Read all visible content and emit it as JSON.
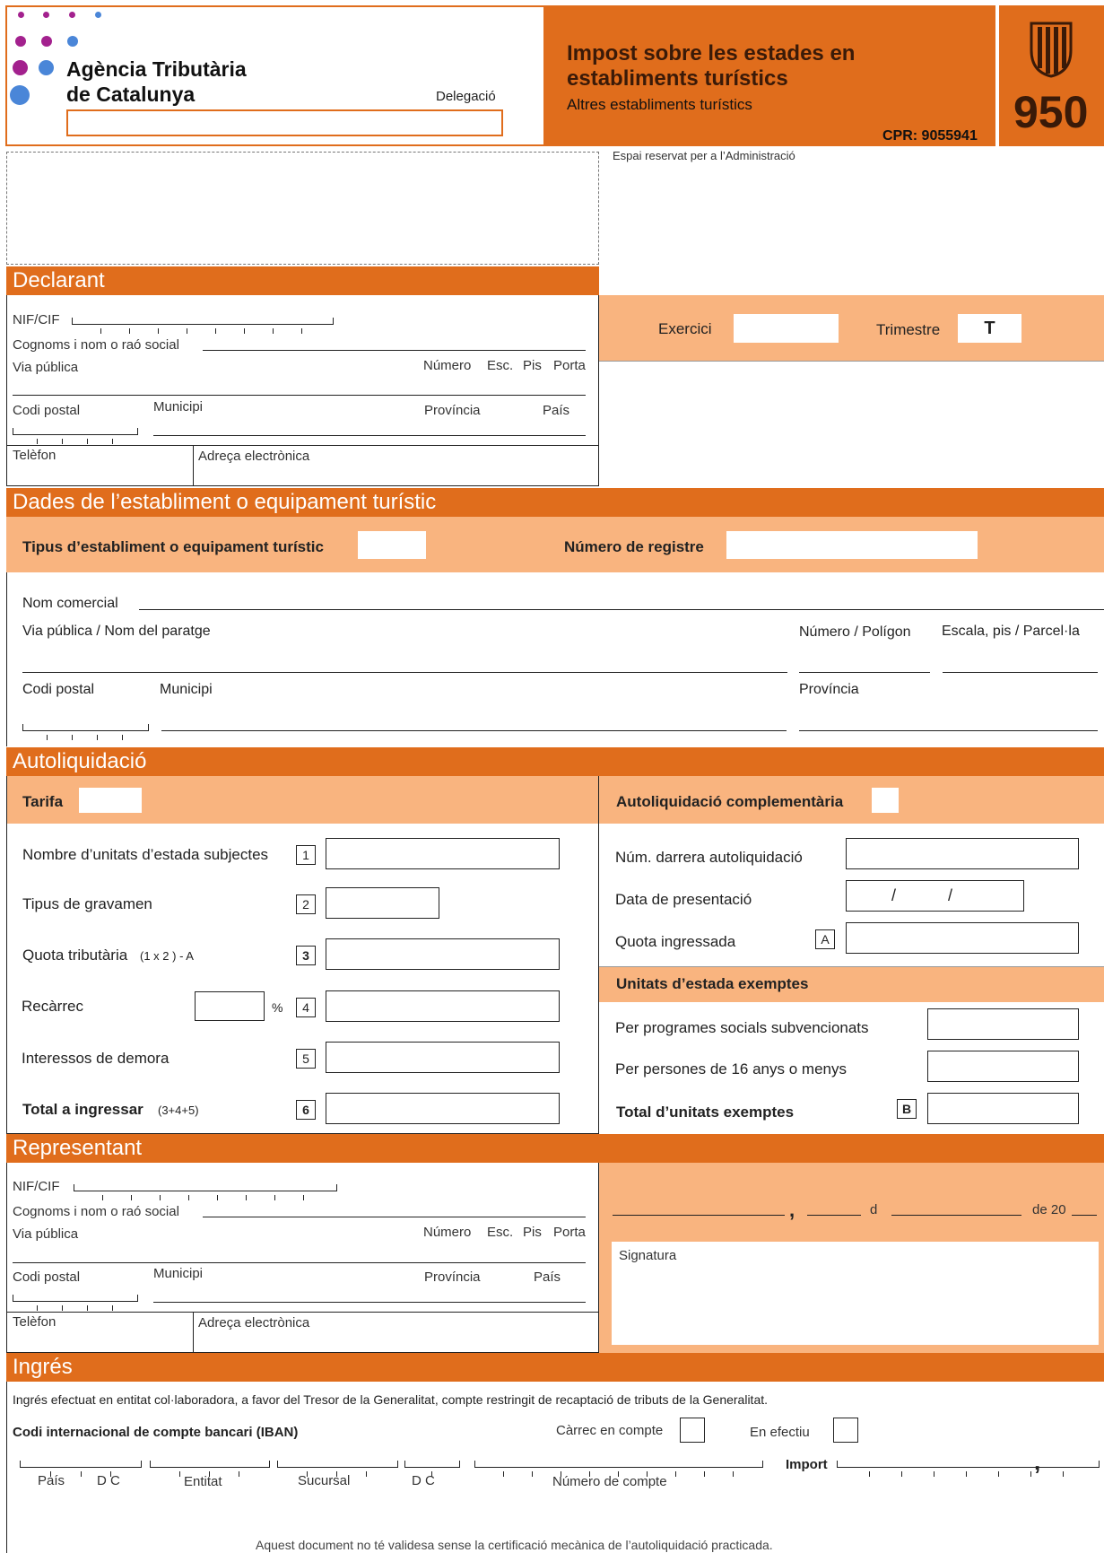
{
  "header": {
    "agency_line1": "Agència Tributària",
    "agency_line2": "de Catalunya",
    "delegacio_label": "Delegació",
    "title_line1": "Impost sobre les estades en",
    "title_line2": "establiments turístics",
    "subtitle": "Altres establiments turístics",
    "cpr": "CPR: 9055941",
    "model_number": "950",
    "admin_space_label": "Espai reservat per a l’Administració",
    "colors": {
      "orange": "#e06d1c",
      "light_orange": "#f9b47f",
      "purple": "#a3218e",
      "blue": "#4a86d8"
    },
    "logo_icon": "generalitat-shield-icon"
  },
  "declarant": {
    "section_title": "Declarant",
    "nif_label": "NIF/CIF",
    "name_label": "Cognoms i nom o raó social",
    "street_label": "Via pública",
    "numero_label": "Número",
    "esc_label": "Esc.",
    "pis_label": "Pis",
    "porta_label": "Porta",
    "postal_label": "Codi postal",
    "municipi_label": "Municipi",
    "provincia_label": "Província",
    "pais_label": "País",
    "phone_label": "Telèfon",
    "email_label": "Adreça electrònica"
  },
  "period": {
    "exercici_label": "Exercici",
    "trimestre_label": "Trimestre",
    "trimestre_value": "T"
  },
  "establishment": {
    "section_title": "Dades de l’establiment o equipament turístic",
    "type_label": "Tipus d’establiment o equipament turístic",
    "registry_label": "Número de registre",
    "trade_name_label": "Nom comercial",
    "street_label": "Via pública / Nom del paratge",
    "number_label": "Número / Polígon",
    "stair_label": "Escala, pis / Parcel·la",
    "postal_label": "Codi postal",
    "municipi_label": "Municipi",
    "provincia_label": "Província"
  },
  "selfassessment": {
    "section_title": "Autoliquidació",
    "tarifa_label": "Tarifa",
    "rows": [
      {
        "label": "Nombre d’unitats d’estada subjectes",
        "box": "1"
      },
      {
        "label": "Tipus de gravamen",
        "box": "2"
      },
      {
        "label": "Quota tributària",
        "formula": "(1 x 2 ) - A",
        "box": "3"
      },
      {
        "label": "Recàrrec",
        "unit": "%",
        "box": "4"
      },
      {
        "label": "Interessos de demora",
        "box": "5"
      },
      {
        "label": "Total a ingressar",
        "formula": "(3+4+5)",
        "box": "6"
      }
    ],
    "complementary_label": "Autoliquidació complementària",
    "last_number_label": "Núm. darrera autoliquidació",
    "date_label": "Data de presentació",
    "date_sep": "/",
    "paid_label": "Quota ingressada",
    "paid_box": "A",
    "exempt_title": "Unitats d’estada exemptes",
    "exempt_social_label": "Per programes socials subvencionats",
    "exempt_under16_label": "Per persones de 16 anys o menys",
    "exempt_total_label": "Total d’unitats exemptes",
    "exempt_total_box": "B"
  },
  "representative": {
    "section_title": "Representant",
    "nif_label": "NIF/CIF",
    "name_label": "Cognoms i nom o raó social",
    "street_label": "Via pública",
    "numero_label": "Número",
    "esc_label": "Esc.",
    "pis_label": "Pis",
    "porta_label": "Porta",
    "postal_label": "Codi postal",
    "municipi_label": "Municipi",
    "provincia_label": "Província",
    "pais_label": "País",
    "phone_label": "Telèfon",
    "email_label": "Adreça electrònica",
    "date_comma": ",",
    "date_d": "d",
    "date_de20": "de 20",
    "signature_label": "Signatura"
  },
  "payment": {
    "section_title": "Ingrés",
    "description": "Ingrés efectuat en entitat col·laboradora, a favor del Tresor de la Generalitat, compte restringit de recaptació de tributs de la Generalitat.",
    "iban_label": "Codi internacional de compte bancari (IBAN)",
    "charge_label": "Càrrec en compte",
    "cash_label": "En efectiu",
    "import_label": "Import",
    "import_comma": ",",
    "col_pais": "País",
    "col_dc1": "D C",
    "col_entitat": "Entitat",
    "col_sucursal": "Sucursal",
    "col_dc2": "D C",
    "col_compte": "Número de compte",
    "footer": "Aquest document no té validesa sense la certificació mecànica de l’autoliquidació practicada."
  }
}
